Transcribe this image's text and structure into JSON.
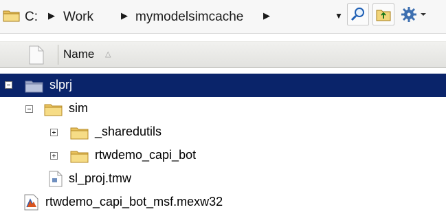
{
  "address": {
    "crumbs": [
      "C:",
      "Work",
      "mymodelsimcache"
    ],
    "separator": "▶",
    "dropdown": "▼"
  },
  "toolbar": {
    "search_icon": "magnifier-icon",
    "up_folder_icon": "up-folder-icon",
    "settings_icon": "gear-icon"
  },
  "columns": {
    "name": "Name",
    "sort_glyph": "△"
  },
  "tree": {
    "items": [
      {
        "label": "slprj",
        "type": "folder",
        "expanded": true,
        "selected": true
      },
      {
        "label": "sim",
        "type": "folder",
        "expanded": true
      },
      {
        "label": "_sharedutils",
        "type": "folder",
        "expanded": false
      },
      {
        "label": "rtwdemo_capi_bot",
        "type": "folder",
        "expanded": false
      },
      {
        "label": "sl_proj.tmw",
        "type": "file"
      },
      {
        "label": "rtwdemo_capi_bot_msf.mexw32",
        "type": "mex-file"
      }
    ]
  },
  "colors": {
    "selection": "#0a246a",
    "folder": "#f2d57a"
  }
}
